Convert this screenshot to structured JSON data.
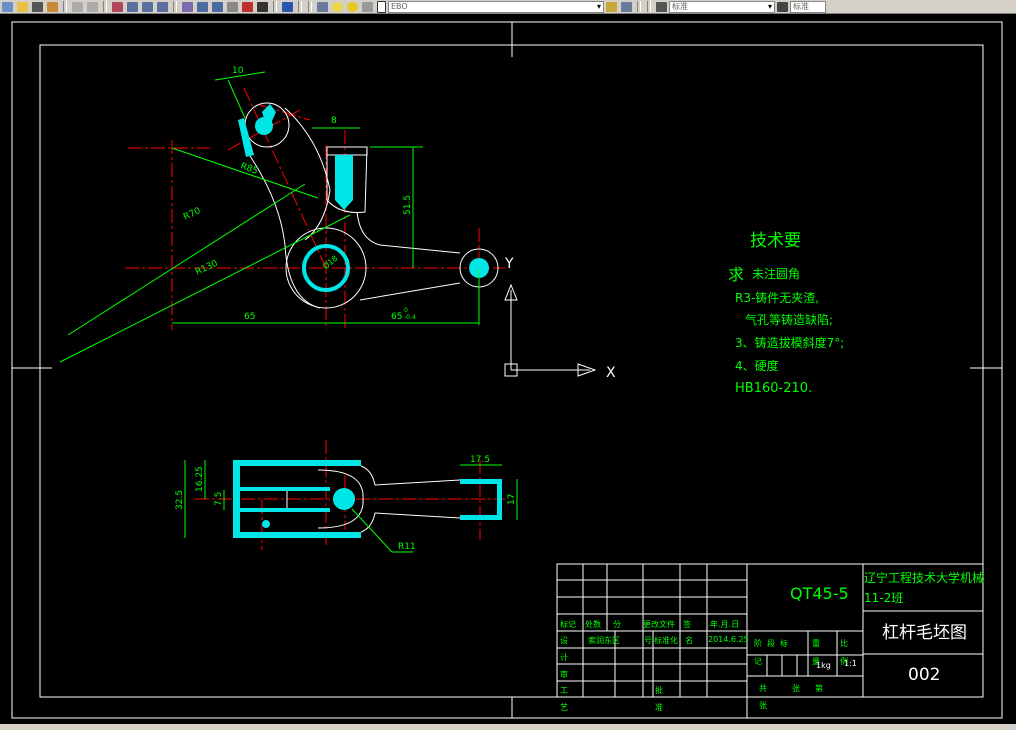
{
  "toolbar": {
    "layer_value": "EBO",
    "style_value": "标准",
    "style_value2": "标准",
    "icons": [
      "new-icon",
      "open-icon",
      "pen-icon",
      "match-icon",
      "undo-icon",
      "redo-icon",
      "pan-icon",
      "zoom-icon",
      "zoom-window-icon",
      "zoom-prev-icon",
      "properties-icon",
      "design-center-icon",
      "tool-palette-icon",
      "markup-icon",
      "calc-icon",
      "help-icon",
      "layer-icon",
      "bulb-icon",
      "sun-icon",
      "lock-icon",
      "color-icon"
    ]
  },
  "drawing": {
    "dims": {
      "d10": "10",
      "d8": "8",
      "r85": "R85",
      "r70": "R70",
      "r130": "R130",
      "phi18": "Ø18",
      "d515": "51.5",
      "d65": "65",
      "d65b": "65",
      "tol_up": "0",
      "tol_dn": "-0.4",
      "d175": "17.5",
      "d325": "32.5",
      "d1625": "16.25",
      "d75": "7.5",
      "r11": "R11",
      "d17": "17"
    },
    "ucs": {
      "x": "X",
      "y": "Y"
    }
  },
  "notes": {
    "title": "技术要",
    "title2": "求",
    "lines": [
      "未注圆角",
      "R3-铸件无夹渣,",
      "气孔等铸造缺陷;",
      "3、铸造拔模斜度7°;",
      "4、硬度",
      "HB160-210."
    ]
  },
  "title_block": {
    "material": "QT45-5",
    "school": "辽宁工程技术大学机械",
    "class": "11-2班",
    "drawing_name": "杠杆毛坯图",
    "drawing_no": "002",
    "header": [
      "标记",
      "处数",
      "分",
      "更改文件",
      "签",
      "年.月.日"
    ],
    "design_row": [
      "设",
      "索润东区",
      "号",
      "标准化",
      "名",
      "2014.6.25"
    ],
    "left_labels": [
      "计",
      "审",
      "工",
      "艺"
    ],
    "approve": [
      "批",
      "准"
    ],
    "stage": [
      "阶",
      "段",
      "标"
    ],
    "stage2": "记",
    "weight_label": [
      "重",
      "量"
    ],
    "weight": "1kg",
    "scale_label": [
      "比",
      "例"
    ],
    "scale": "1:1",
    "sheet": [
      "共",
      "张",
      "第"
    ],
    "sheet2": "张"
  },
  "colors": {
    "bg": "#000000",
    "line": "#ffffff",
    "dim": "#00ff00",
    "center": "#ff0000",
    "hatch": "#00ffff",
    "text": "#00ff00"
  }
}
